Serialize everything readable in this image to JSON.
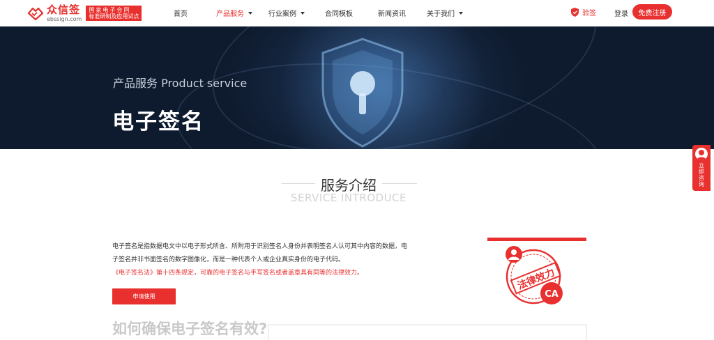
{
  "header": {
    "logo": {
      "name": "众信签",
      "domain": "ebssign.com",
      "badge_line1": "国家电子合同",
      "badge_line2": "标准研制及应用试点"
    },
    "nav": [
      {
        "label": "首页",
        "active": false,
        "dropdown": false
      },
      {
        "label": "产品服务",
        "active": true,
        "dropdown": true
      },
      {
        "label": "行业案例",
        "active": false,
        "dropdown": true
      },
      {
        "label": "合同模板",
        "active": false,
        "dropdown": false
      },
      {
        "label": "新闻资讯",
        "active": false,
        "dropdown": false
      },
      {
        "label": "关于我们",
        "active": false,
        "dropdown": true
      }
    ],
    "verify_label": "验签",
    "login_label": "登录",
    "register_label": "免费注册"
  },
  "banner": {
    "subtitle": "产品服务 Product service",
    "title": "电子签名"
  },
  "float_consult": {
    "label": "立即咨询"
  },
  "section": {
    "title": "服务介绍",
    "title_en": "SERVICE INTRODUCE"
  },
  "intro": {
    "line1": "电子签名是指数据电文中以电子形式所含、所附用于识别签名人身份并表明签名人认可其中内容的数据，电",
    "line2": "子签名并非书面签名的数字图像化，而是一种代表个人或企业真实身份的电子代码。",
    "line3": "《电子签名法》第十四条规定，可靠的电子签名与手写签名或者盖章具有同等的法律效力。",
    "apply_label": "申请使用"
  },
  "stamp": {
    "text": "法律效力",
    "ca": "CA"
  },
  "how": {
    "title": "如何确保电子签名有效?"
  },
  "colors": {
    "brand_red": "#e8302f",
    "banner_dark": "#172a46"
  }
}
